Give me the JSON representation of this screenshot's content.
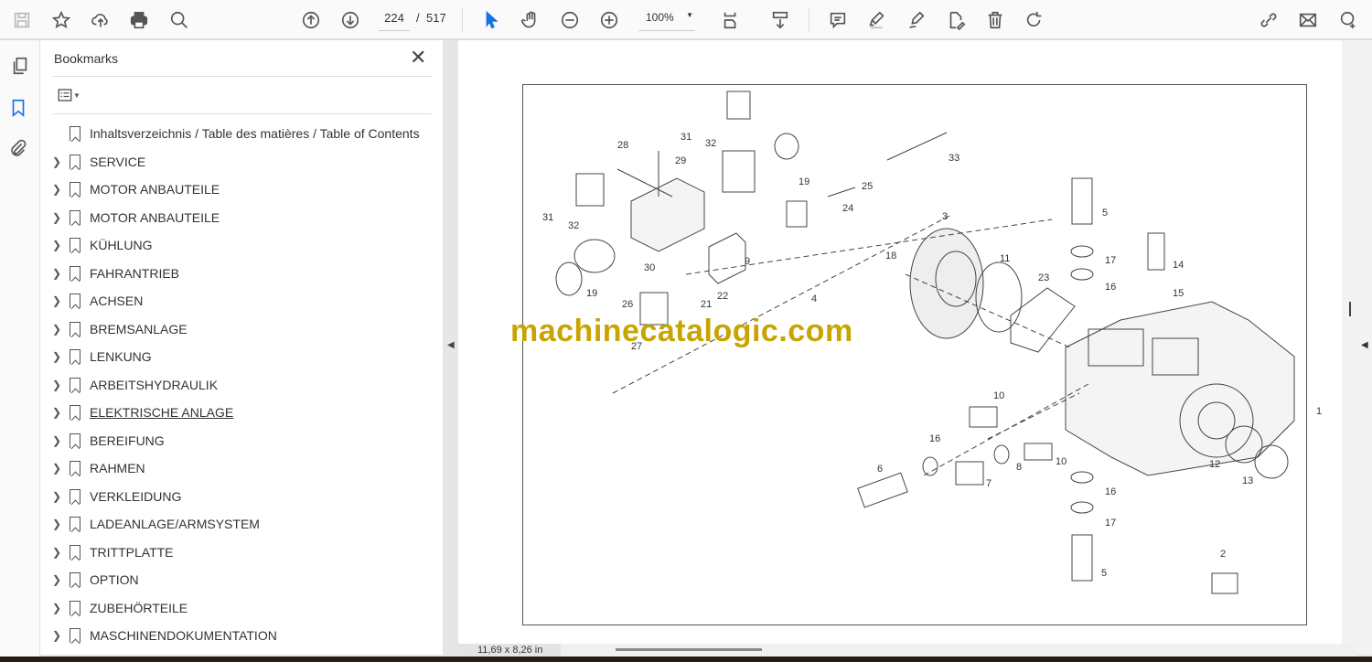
{
  "toolbar": {
    "current_page": "224",
    "page_separator": "/",
    "total_pages": "517",
    "zoom": "100%",
    "left_icons": [
      "save-icon",
      "star-icon",
      "cloud-upload-icon",
      "print-icon",
      "search-zoom-icon",
      "page-up-icon",
      "page-down-icon",
      "select-arrow-icon",
      "hand-icon",
      "zoom-out-icon",
      "zoom-in-icon"
    ],
    "right_icons": [
      "page-fit-icon",
      "scroll-mode-icon",
      "comment-icon",
      "highlight-icon",
      "sign-icon",
      "edit-pdf-icon",
      "delete-icon",
      "rotate-icon",
      "share-link-icon",
      "email-icon",
      "add-user-icon"
    ]
  },
  "bookmarks": {
    "title": "Bookmarks",
    "items": [
      {
        "label": "Inhaltsverzeichnis / Table des matières / Table of Contents",
        "expandable": false
      },
      {
        "label": "SERVICE",
        "expandable": true
      },
      {
        "label": "MOTOR ANBAUTEILE",
        "expandable": true
      },
      {
        "label": "MOTOR ANBAUTEILE",
        "expandable": true
      },
      {
        "label": "KÜHLUNG",
        "expandable": true
      },
      {
        "label": "FAHRANTRIEB",
        "expandable": true
      },
      {
        "label": "ACHSEN",
        "expandable": true
      },
      {
        "label": "BREMSANLAGE",
        "expandable": true
      },
      {
        "label": "LENKUNG",
        "expandable": true
      },
      {
        "label": "ARBEITSHYDRAULIK",
        "expandable": true
      },
      {
        "label": "ELEKTRISCHE ANLAGE",
        "expandable": true,
        "underlined": true
      },
      {
        "label": "BEREIFUNG",
        "expandable": true
      },
      {
        "label": "RAHMEN",
        "expandable": true
      },
      {
        "label": "VERKLEIDUNG",
        "expandable": true
      },
      {
        "label": "LADEANLAGE/ARMSYSTEM",
        "expandable": true
      },
      {
        "label": "TRITTPLATTE",
        "expandable": true
      },
      {
        "label": "OPTION",
        "expandable": true
      },
      {
        "label": "ZUBEHÖRTEILE",
        "expandable": true
      },
      {
        "label": "MASCHINENDOKUMENTATION",
        "expandable": true
      }
    ]
  },
  "document": {
    "watermark": "machinecatalogic.com",
    "watermark_color": "#c9a400",
    "part_labels": [
      "28",
      "29",
      "31",
      "32",
      "33",
      "19",
      "25",
      "24",
      "31",
      "32",
      "3",
      "5",
      "17",
      "16",
      "14",
      "15",
      "18",
      "11",
      "23",
      "30",
      "9",
      "19",
      "4",
      "26",
      "22",
      "21",
      "27",
      "1",
      "10",
      "16",
      "10",
      "8",
      "7",
      "6",
      "12",
      "13",
      "16",
      "17",
      "5",
      "2"
    ]
  },
  "status": {
    "page_size": "11,69 x 8,26 in"
  },
  "accent": "#1473e6"
}
